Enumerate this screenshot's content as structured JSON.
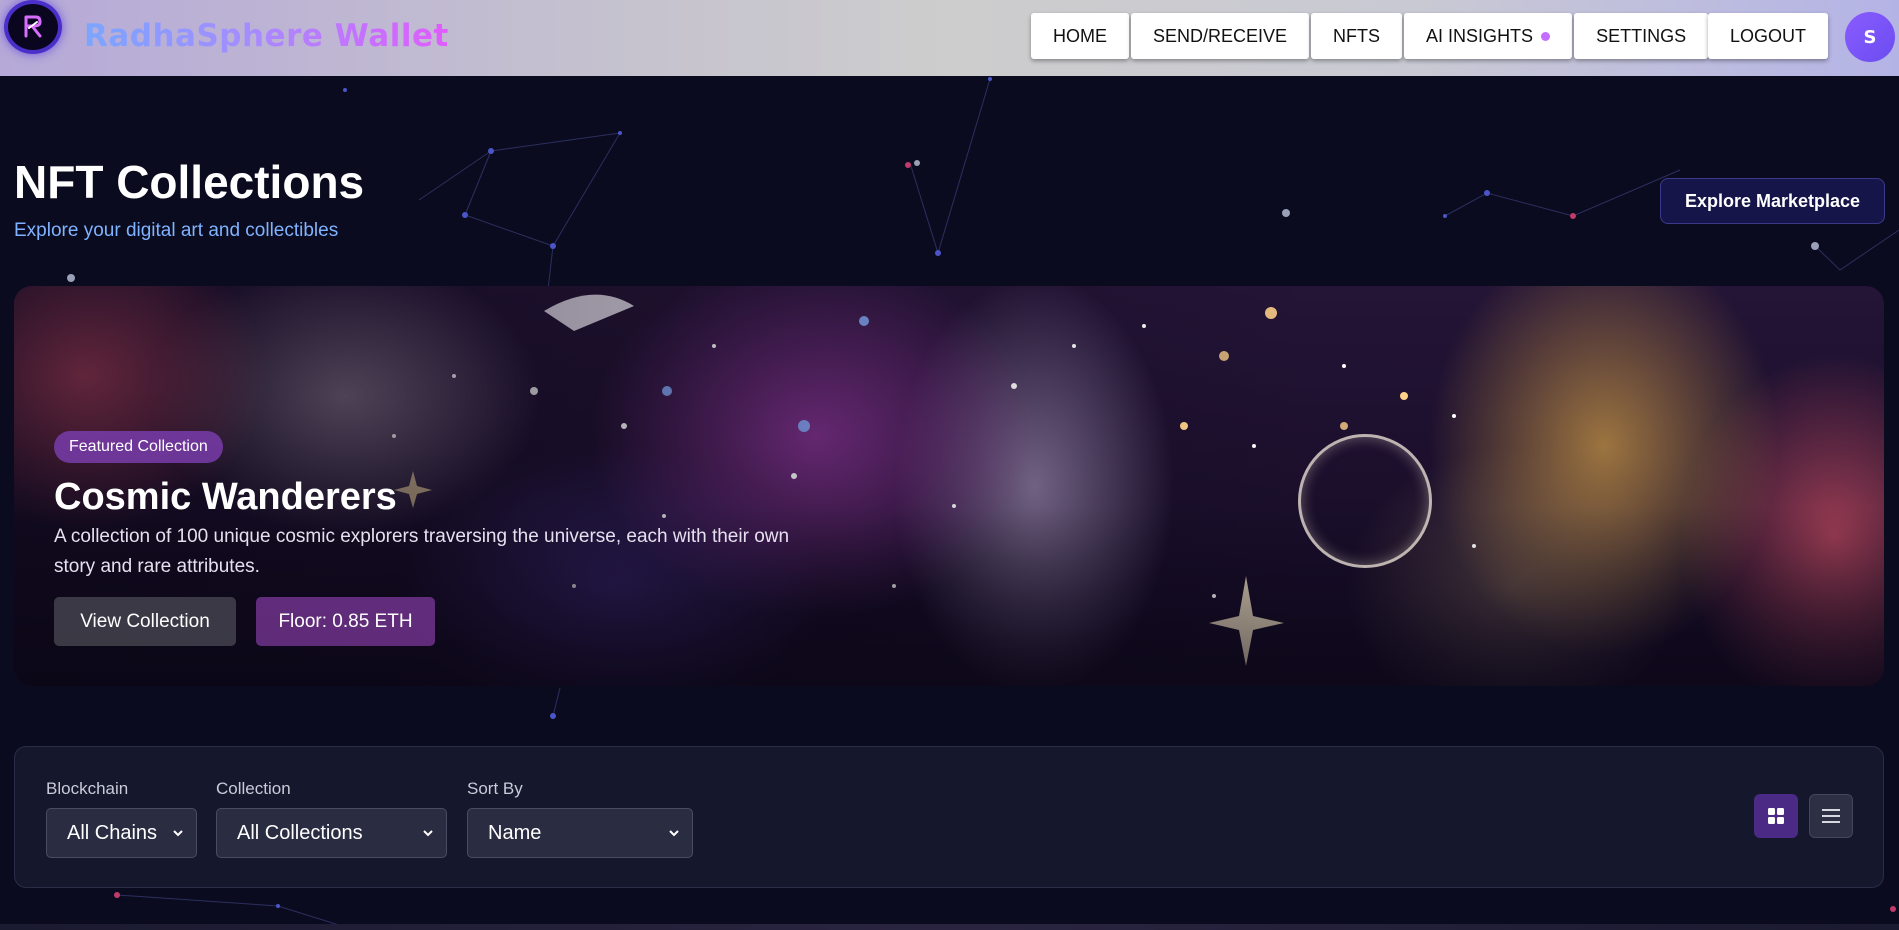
{
  "header": {
    "brand": "RadhaSphere Wallet",
    "nav": [
      "HOME",
      "SEND/RECEIVE",
      "NFTS",
      "AI INSIGHTS",
      "SETTINGS"
    ],
    "logout": "LOGOUT",
    "avatar_initial": "S"
  },
  "page": {
    "title": "NFT Collections",
    "subtitle": "Explore your digital art and collectibles",
    "explore_button": "Explore Marketplace"
  },
  "featured": {
    "badge": "Featured Collection",
    "title": "Cosmic Wanderers",
    "description": "A collection of 100 unique cosmic explorers traversing the universe, each with their own story and rare attributes.",
    "view_button": "View Collection",
    "floor": "Floor: 0.85 ETH"
  },
  "filters": {
    "blockchain_label": "Blockchain",
    "blockchain_value": "All Chains",
    "collection_label": "Collection",
    "collection_value": "All Collections",
    "sort_label": "Sort By",
    "sort_value": "Name"
  },
  "colors": {
    "background": "#0a0b1e",
    "accent": "#c46dff",
    "subtitle": "#7fb2ff"
  }
}
